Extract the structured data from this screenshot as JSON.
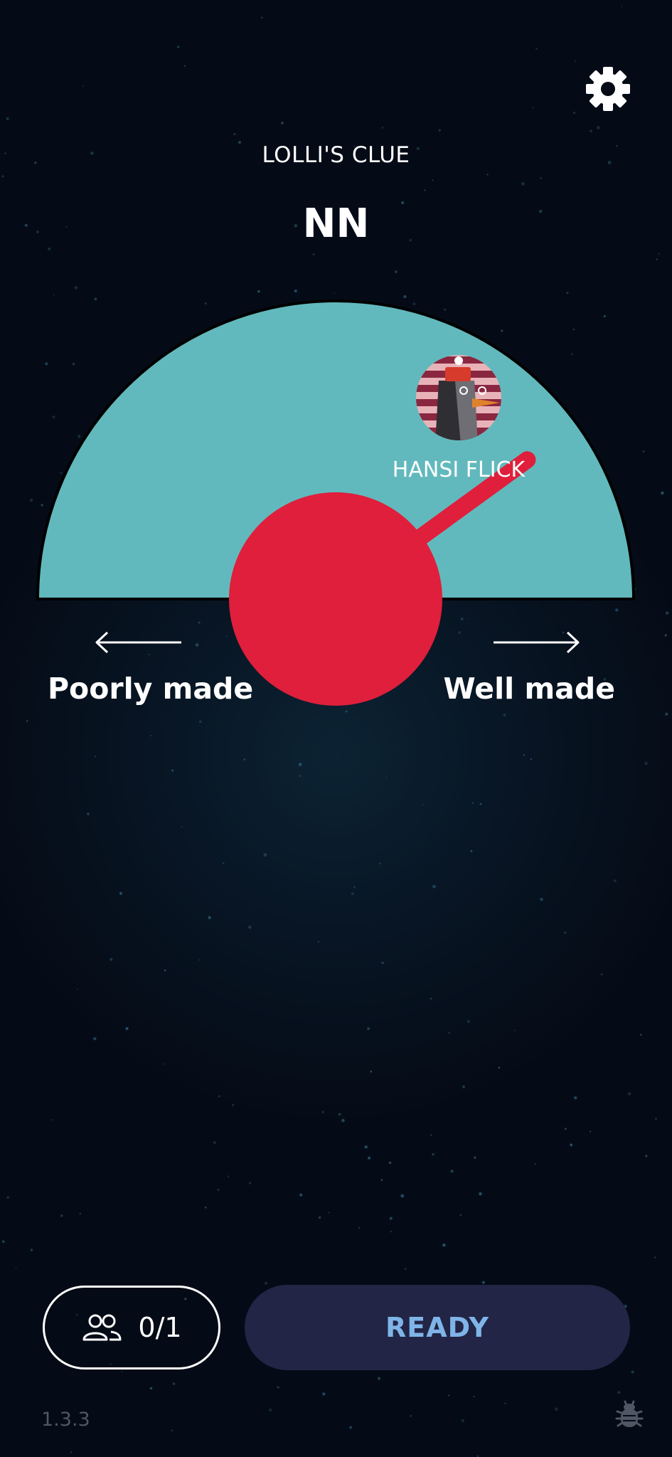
{
  "header": {
    "clue_caption": "LOLLI'S CLUE",
    "clue_text": "NN"
  },
  "dial": {
    "player_name": "HANSI FLICK",
    "needle_position_percent": 80,
    "colors": {
      "dial_fill": "#62b9bd",
      "needle": "#df1f3b",
      "background": "#050b16"
    }
  },
  "scale": {
    "left_label": "Poorly made",
    "right_label": "Well made"
  },
  "footer": {
    "players_count": "0/1",
    "ready_label": "READY",
    "version": "1.3.3"
  },
  "icons": {
    "settings": "gear-icon",
    "players": "people-icon",
    "debug": "bug-icon",
    "avatar": "snowman-avatar-icon"
  }
}
